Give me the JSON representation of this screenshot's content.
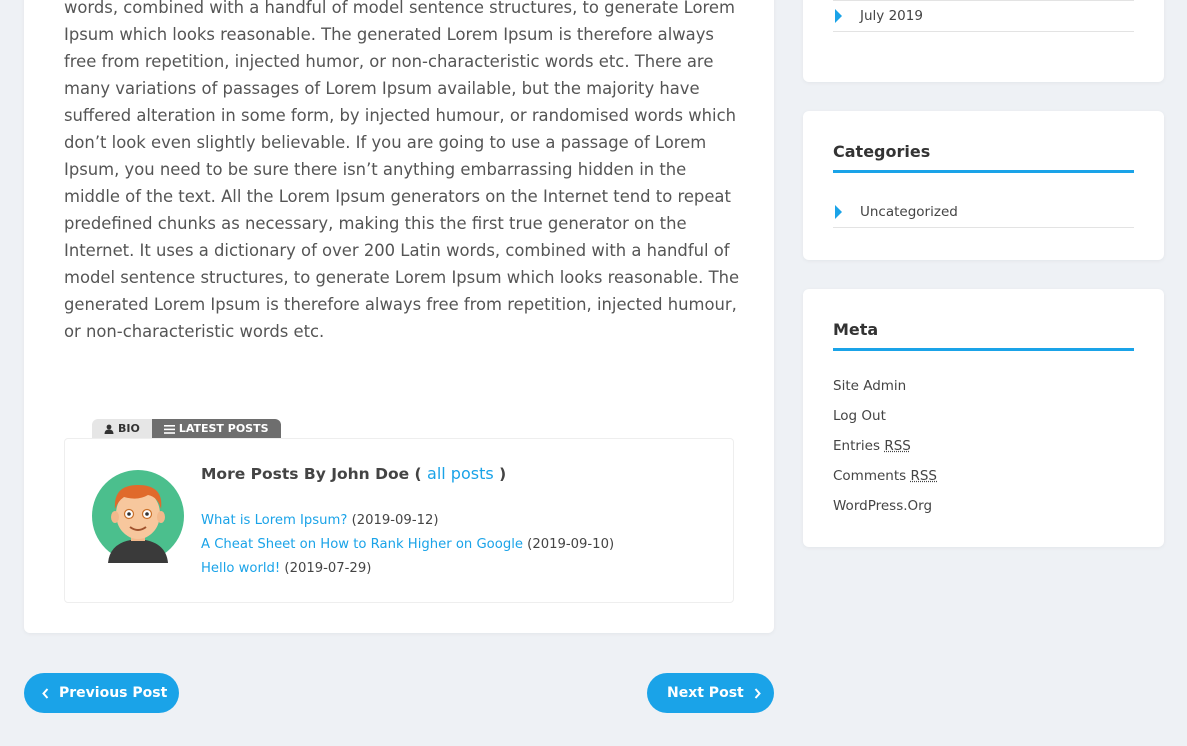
{
  "article": {
    "body": "words, combined with a handful of model sentence structures, to generate Lorem Ipsum which looks reasonable. The generated Lorem Ipsum is therefore always free from repetition, injected humor, or non-characteristic words etc. There are many variations of passages of Lorem Ipsum available, but the majority have suffered alteration in some form, by injected humour, or randomised words which don’t look even slightly believable. If you are going to use a passage of Lorem Ipsum, you need to be sure there isn’t anything embarrassing hidden in the middle of the text. All the Lorem Ipsum generators on the Internet tend to repeat predefined chunks as necessary, making this the first true generator on the Internet. It uses a dictionary of over 200 Latin words, combined with a handful of model sentence structures, to generate Lorem Ipsum which looks reasonable. The generated Lorem Ipsum is therefore always free from repetition, injected humour, or non-characteristic words etc."
  },
  "author_box": {
    "tabs": [
      {
        "label": "BIO",
        "icon": "user-icon"
      },
      {
        "label": "LATEST POSTS",
        "icon": "list-icon"
      }
    ],
    "more_posts_prefix": "More Posts By John Doe (",
    "all_posts_label": "all posts",
    "more_posts_suffix": ")",
    "posts": [
      {
        "title": "What is Lorem Ipsum?",
        "date": "(2019-09-12)"
      },
      {
        "title": "A Cheat Sheet on How to Rank Higher on Google",
        "date": "(2019-09-10)"
      },
      {
        "title": "Hello world!",
        "date": "(2019-07-29)"
      }
    ]
  },
  "post_nav": {
    "previous_label": "Previous Post",
    "next_label": "Next Post"
  },
  "sidebar": {
    "archives": {
      "items": [
        "July 2019"
      ]
    },
    "categories": {
      "title": "Categories",
      "items": [
        "Uncategorized"
      ]
    },
    "meta": {
      "title": "Meta",
      "site_admin": "Site Admin",
      "log_out": "Log Out",
      "entries_prefix": "Entries",
      "comments_prefix": "Comments",
      "rss": "RSS",
      "wordpress": "WordPress.Org"
    }
  },
  "colors": {
    "accent": "#1aa3e8",
    "background": "#eef1f5",
    "card": "#ffffff"
  }
}
